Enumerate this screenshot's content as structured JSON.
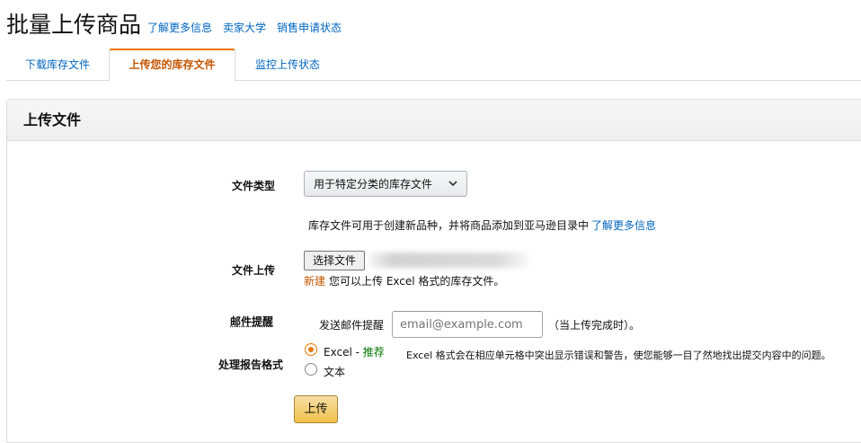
{
  "page": {
    "title": "批量上传商品",
    "links": [
      "了解更多信息",
      "卖家大学",
      "销售申请状态"
    ]
  },
  "tabs": [
    {
      "label": "下载库存文件",
      "active": false
    },
    {
      "label": "上传您的库存文件",
      "active": true
    },
    {
      "label": "监控上传状态",
      "active": false
    }
  ],
  "panel": {
    "title": "上传文件",
    "file_type": {
      "label": "文件类型",
      "selected": "用于特定分类的库存文件",
      "info": "库存文件可用于创建新品种，并将商品添加到亚马逊目录中",
      "info_link": "了解更多信息"
    },
    "file_upload": {
      "label": "文件上传",
      "button": "选择文件",
      "new_badge": "新建",
      "note": "您可以上传 Excel 格式的库存文件。"
    },
    "email": {
      "label": "邮件提醒",
      "prefix": "发送邮件提醒",
      "placeholder": "email@example.com",
      "suffix": "（当上传完成时）。"
    },
    "report_format": {
      "label": "处理报告格式",
      "options": [
        {
          "label": "Excel - ",
          "tag": "推荐",
          "checked": true
        },
        {
          "label": "文本",
          "tag": "",
          "checked": false
        }
      ],
      "description": "Excel 格式会在相应单元格中突出显示错误和警告，使您能够一目了然地找出提交内容中的问题。"
    },
    "upload_button": "上传"
  },
  "colors": {
    "link": "#0066c0",
    "active_tab": "#c45500",
    "tab_accent": "#e77600",
    "recommended": "#007600",
    "button_yellow": "#f0c14b"
  }
}
